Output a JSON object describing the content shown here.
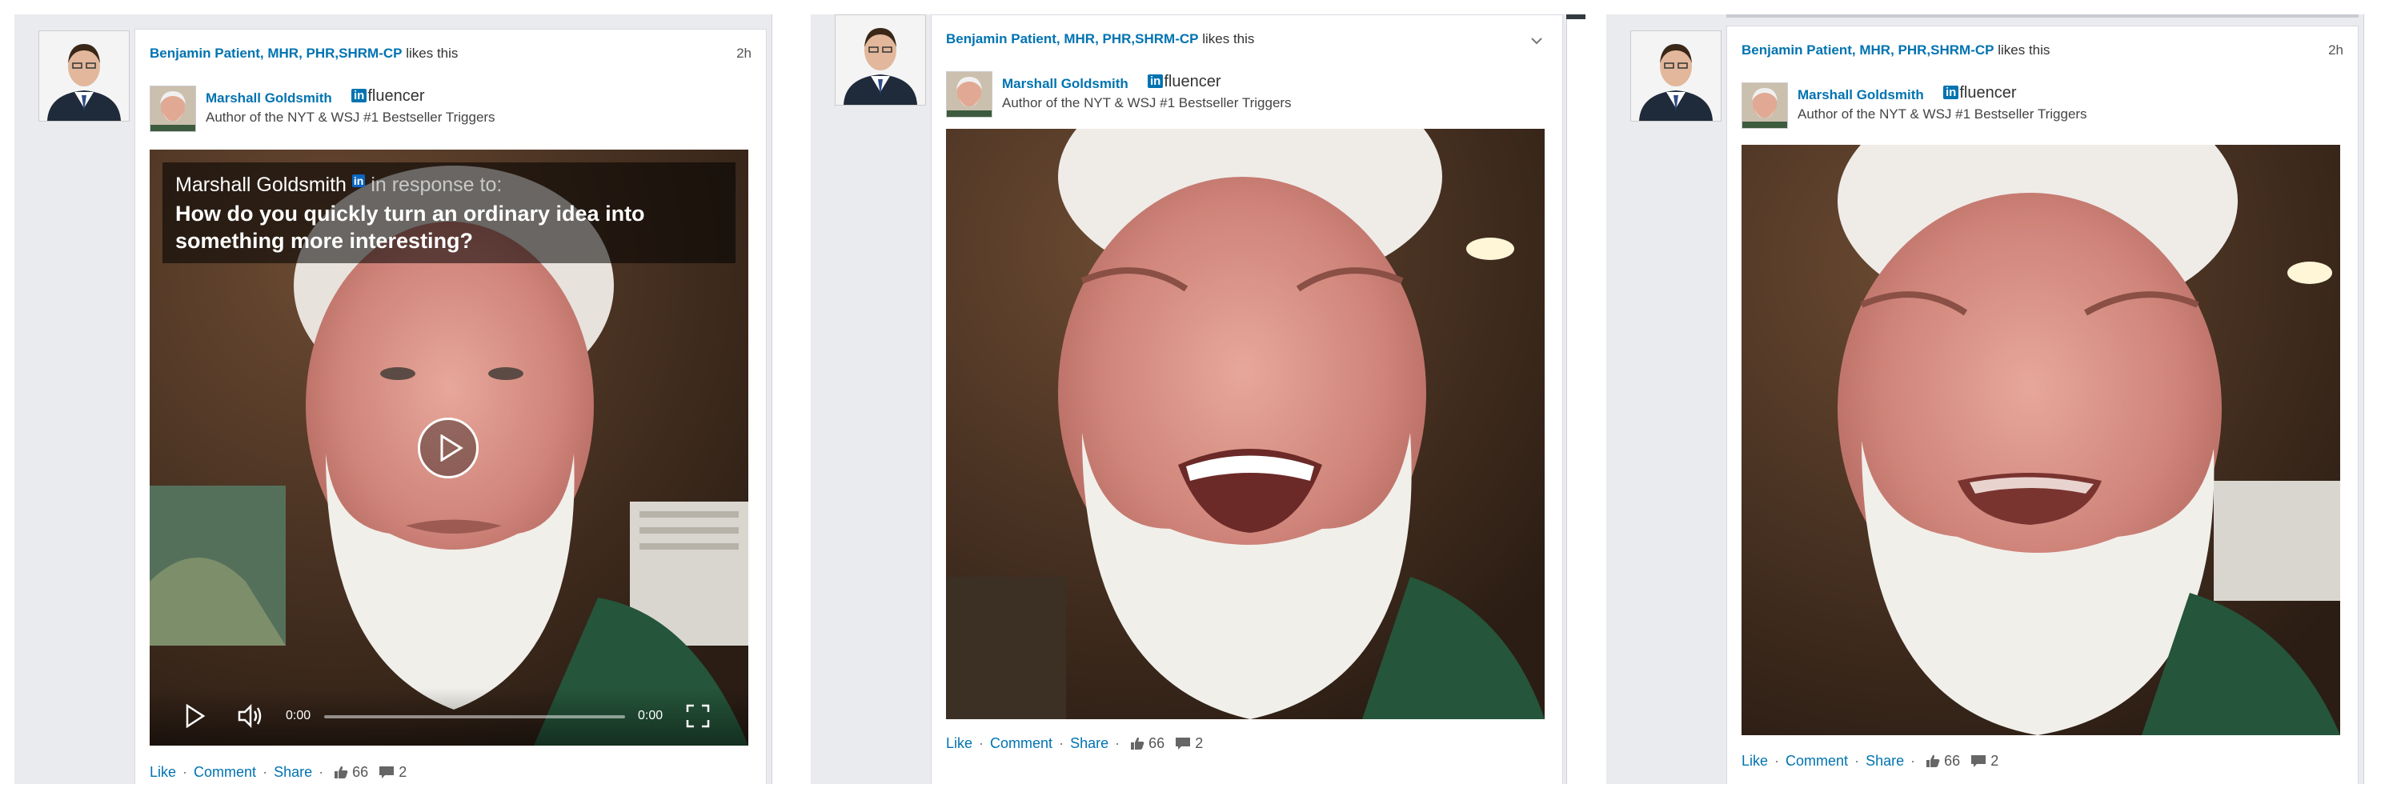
{
  "feed_items": [
    {
      "liker_name": "Benjamin Patient, MHR, PHR,SHRM-CP",
      "liker_action": " likes this",
      "time": "2h",
      "author_name": "Marshall Goldsmith",
      "badge_in": "in",
      "badge_text": "fluencer",
      "author_title": "Author of the NYT & WSJ #1 Bestseller Triggers",
      "like_label": "Like",
      "comment_label": "Comment",
      "share_label": "Share",
      "like_count": "66",
      "comment_count": "2",
      "overlay": {
        "name": "Marshall Goldsmith",
        "in": "in",
        "response": "in response to:",
        "question": "How do you quickly turn an ordinary idea into something more interesting?"
      },
      "controls": {
        "current_time": "0:00",
        "duration": "0:00"
      }
    },
    {
      "liker_name": "Benjamin Patient, MHR, PHR,SHRM-CP",
      "liker_action": " likes this",
      "author_name": "Marshall Goldsmith",
      "badge_in": "in",
      "badge_text": "fluencer",
      "author_title": "Author of the NYT & WSJ #1 Bestseller Triggers",
      "like_label": "Like",
      "comment_label": "Comment",
      "share_label": "Share",
      "like_count": "66",
      "comment_count": "2"
    },
    {
      "liker_name": "Benjamin Patient, MHR, PHR,SHRM-CP",
      "liker_action": " likes this",
      "time": "2h",
      "author_name": "Marshall Goldsmith",
      "badge_in": "in",
      "badge_text": "fluencer",
      "author_title": "Author of the NYT & WSJ #1 Bestseller Triggers",
      "like_label": "Like",
      "comment_label": "Comment",
      "share_label": "Share",
      "like_count": "66",
      "comment_count": "2"
    }
  ],
  "colors": {
    "link_blue": "#0073b1",
    "feed_background": "#e9ebee",
    "card_background": "#ffffff"
  },
  "icons": [
    "play-icon",
    "volume-icon",
    "fullscreen-icon",
    "thumbs-up-icon",
    "comment-bubble-icon",
    "chevron-down-icon"
  ]
}
